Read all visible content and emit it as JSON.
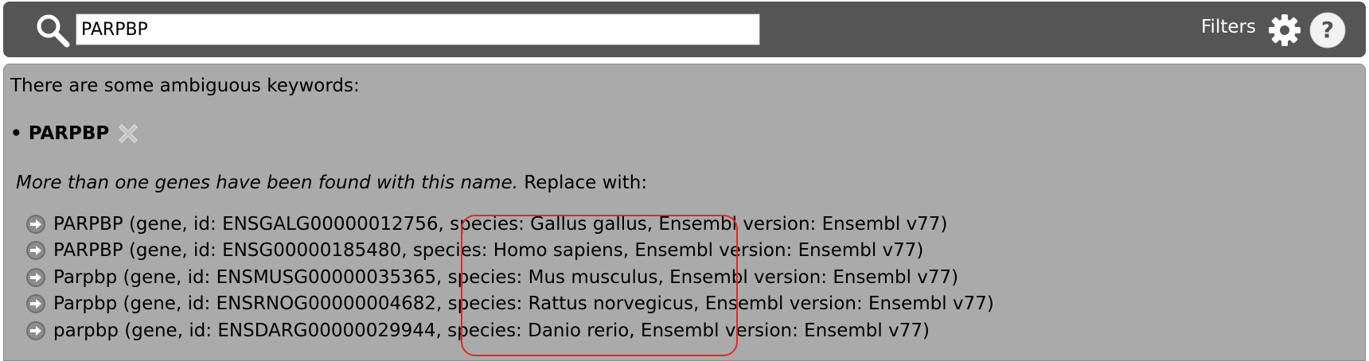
{
  "search": {
    "value": "PARPBP",
    "filters_label": "Filters"
  },
  "icons": {
    "search": "search-icon",
    "gear": "gear-icon",
    "help": "help-icon",
    "remove": "close-icon",
    "arrow": "arrow-right-circle-icon"
  },
  "panel": {
    "intro": "There are some ambiguous keywords:",
    "bullet": "•",
    "keyword": "PARPBP",
    "message_italic": "More than one genes have been found with this name.",
    "message_rest": " Replace with:",
    "options": [
      "PARPBP (gene, id: ENSGALG00000012756, species: Gallus gallus, Ensembl version: Ensembl v77)",
      "PARPBP (gene, id: ENSG00000185480, species: Homo sapiens, Ensembl version: Ensembl v77)",
      "Parpbp (gene, id: ENSMUSG00000035365, species: Mus musculus, Ensembl version: Ensembl v77)",
      "Parpbp (gene, id: ENSRNOG00000004682, species: Rattus norvegicus, Ensembl version: Ensembl v77)",
      "parpbp (gene, id: ENSDARG00000029944, species: Danio rerio, Ensembl version: Ensembl v77)"
    ]
  },
  "colors": {
    "toolbar_bg": "#555555",
    "panel_bg": "#aaaaaa",
    "highlight": "#e02a24"
  }
}
